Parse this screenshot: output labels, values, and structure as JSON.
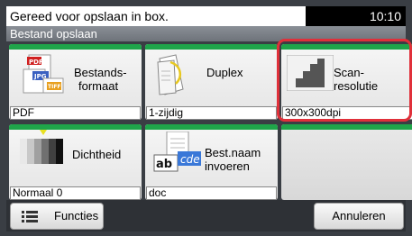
{
  "status": {
    "message": "Gereed voor opslaan in box.",
    "time": "10:10"
  },
  "screen_title": "Bestand opslaan",
  "tiles": [
    {
      "id": "file-format",
      "label_line1": "Bestands-",
      "label_line2": "formaat",
      "value": "PDF",
      "icon": "file-format-icon"
    },
    {
      "id": "duplex",
      "label": "Duplex",
      "value": "1-zijdig",
      "icon": "duplex-icon"
    },
    {
      "id": "scan-resolution",
      "label_line1": "Scan-",
      "label_line2": "resolutie",
      "value": "300x300dpi",
      "icon": "scan-resolution-icon"
    },
    {
      "id": "density",
      "label": "Dichtheid",
      "value": "Normaal 0",
      "icon": "density-icon"
    },
    {
      "id": "file-name",
      "label_line1": "Best.naam",
      "label_line2": "invoeren",
      "value": "doc",
      "icon": "file-name-entry-icon"
    }
  ],
  "bottom": {
    "functions_label": "Functies",
    "cancel_label": "Annuleren"
  },
  "colors": {
    "tile_bar": "#1fa54a",
    "highlight": "#e0303a"
  }
}
